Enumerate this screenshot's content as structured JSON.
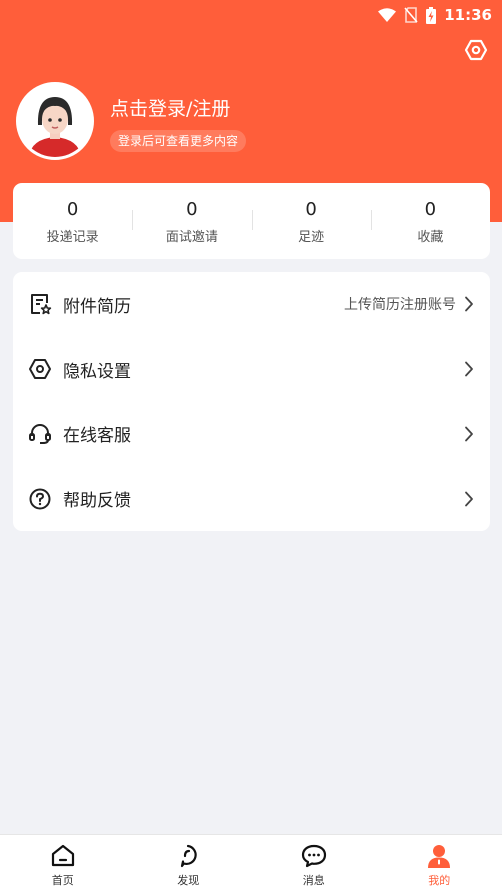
{
  "status_bar": {
    "time": "11:36"
  },
  "profile": {
    "login_title": "点击登录/注册",
    "login_subtitle": "登录后可查看更多内容"
  },
  "stats": [
    {
      "value": "0",
      "label": "投递记录"
    },
    {
      "value": "0",
      "label": "面试邀请"
    },
    {
      "value": "0",
      "label": "足迹"
    },
    {
      "value": "0",
      "label": "收藏"
    }
  ],
  "menu": [
    {
      "label": "附件简历",
      "hint": "上传简历注册账号",
      "icon": "resume-icon"
    },
    {
      "label": "隐私设置",
      "hint": "",
      "icon": "privacy-settings-icon"
    },
    {
      "label": "在线客服",
      "hint": "",
      "icon": "headset-icon"
    },
    {
      "label": "帮助反馈",
      "hint": "",
      "icon": "help-icon"
    }
  ],
  "tabs": [
    {
      "label": "首页",
      "icon": "home-icon",
      "active": false
    },
    {
      "label": "发现",
      "icon": "discover-icon",
      "active": false
    },
    {
      "label": "消息",
      "icon": "message-icon",
      "active": false
    },
    {
      "label": "我的",
      "icon": "profile-icon",
      "active": true
    }
  ],
  "colors": {
    "brand": "#ff5e3a",
    "background": "#f1f2f6"
  }
}
